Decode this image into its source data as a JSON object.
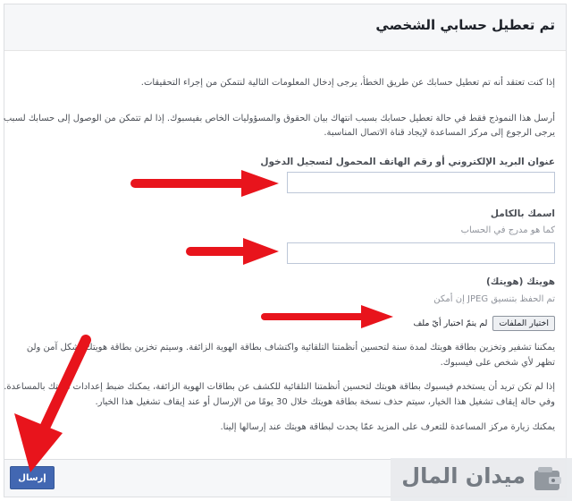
{
  "header": {
    "title": "تم تعطيل حسابي الشخصي"
  },
  "intro": {
    "line1": "إذا كنت تعتقد أنه تم تعطيل حسابك عن طريق الخطأ، يرجى إدخال المعلومات التالية لنتمكن من إجراء التحقيقات."
  },
  "notice": {
    "line1": "أرسل هذا النموذج فقط في حالة تعطيل حسابك بسبب انتهاك بيان الحقوق والمسؤوليات الخاص بفيسبوك. إذا لم تتمكن من الوصول إلى حسابك لسبب مختلف،",
    "line2": "يرجى الرجوع إلى مركز المساعدة لإيجاد قناة الاتصال المناسبة."
  },
  "email_field": {
    "label": "عنوان البريد الإلكتروني أو رقم الهاتف المحمول لتسجيل الدخول",
    "value": ""
  },
  "name_field": {
    "label": "اسمك بالكامل",
    "hint": "كما هو مدرج في الحساب",
    "value": ""
  },
  "id_field": {
    "label": "هويتك (هويتك)",
    "hint": "تم الحفظ بتنسيق JPEG إن أمكن",
    "button_label": "اختيار الملفات",
    "no_file_text": "لم يتمّ اختيار أيّ ملف"
  },
  "info1": {
    "line1": "يمكننا تشفير وتخزين بطاقة هويتك لمدة سنة لتحسين أنظمتنا التلقائية واكتشاف بطاقة الهوية الزائفة. وسيتم تخزين بطاقة هويتك بشكل آمن ولن",
    "line2": "تظهر لأي شخص على فيسبوك."
  },
  "info2": {
    "line1": "إذا لم تكن تريد أن يستخدم فيسبوك بطاقة هويتك لتحسين أنظمتنا التلقائية للكشف عن بطاقات الهوية الزائفة، يمكنك ضبط إعدادات هويتك بالمساعدة.",
    "line2": "وفي حالة إيقاف تشغيل هذا الخيار، سيتم حذف نسخة بطاقة هويتك خلال 30 يومًا من الإرسال أو عند إيقاف تشغيل هذا الخيار."
  },
  "help": {
    "line1": "يمكنك زيارة مركز المساعدة للتعرف على المزيد عمّا يحدث لبطاقة هويتك عند إرسالها إلينا."
  },
  "footer": {
    "submit_label": "إرسال"
  },
  "watermark": {
    "brand": "ميدان المال"
  },
  "colors": {
    "accent": "#4267b2",
    "arrow": "#e8141c",
    "header_bg": "#f6f7f9"
  }
}
